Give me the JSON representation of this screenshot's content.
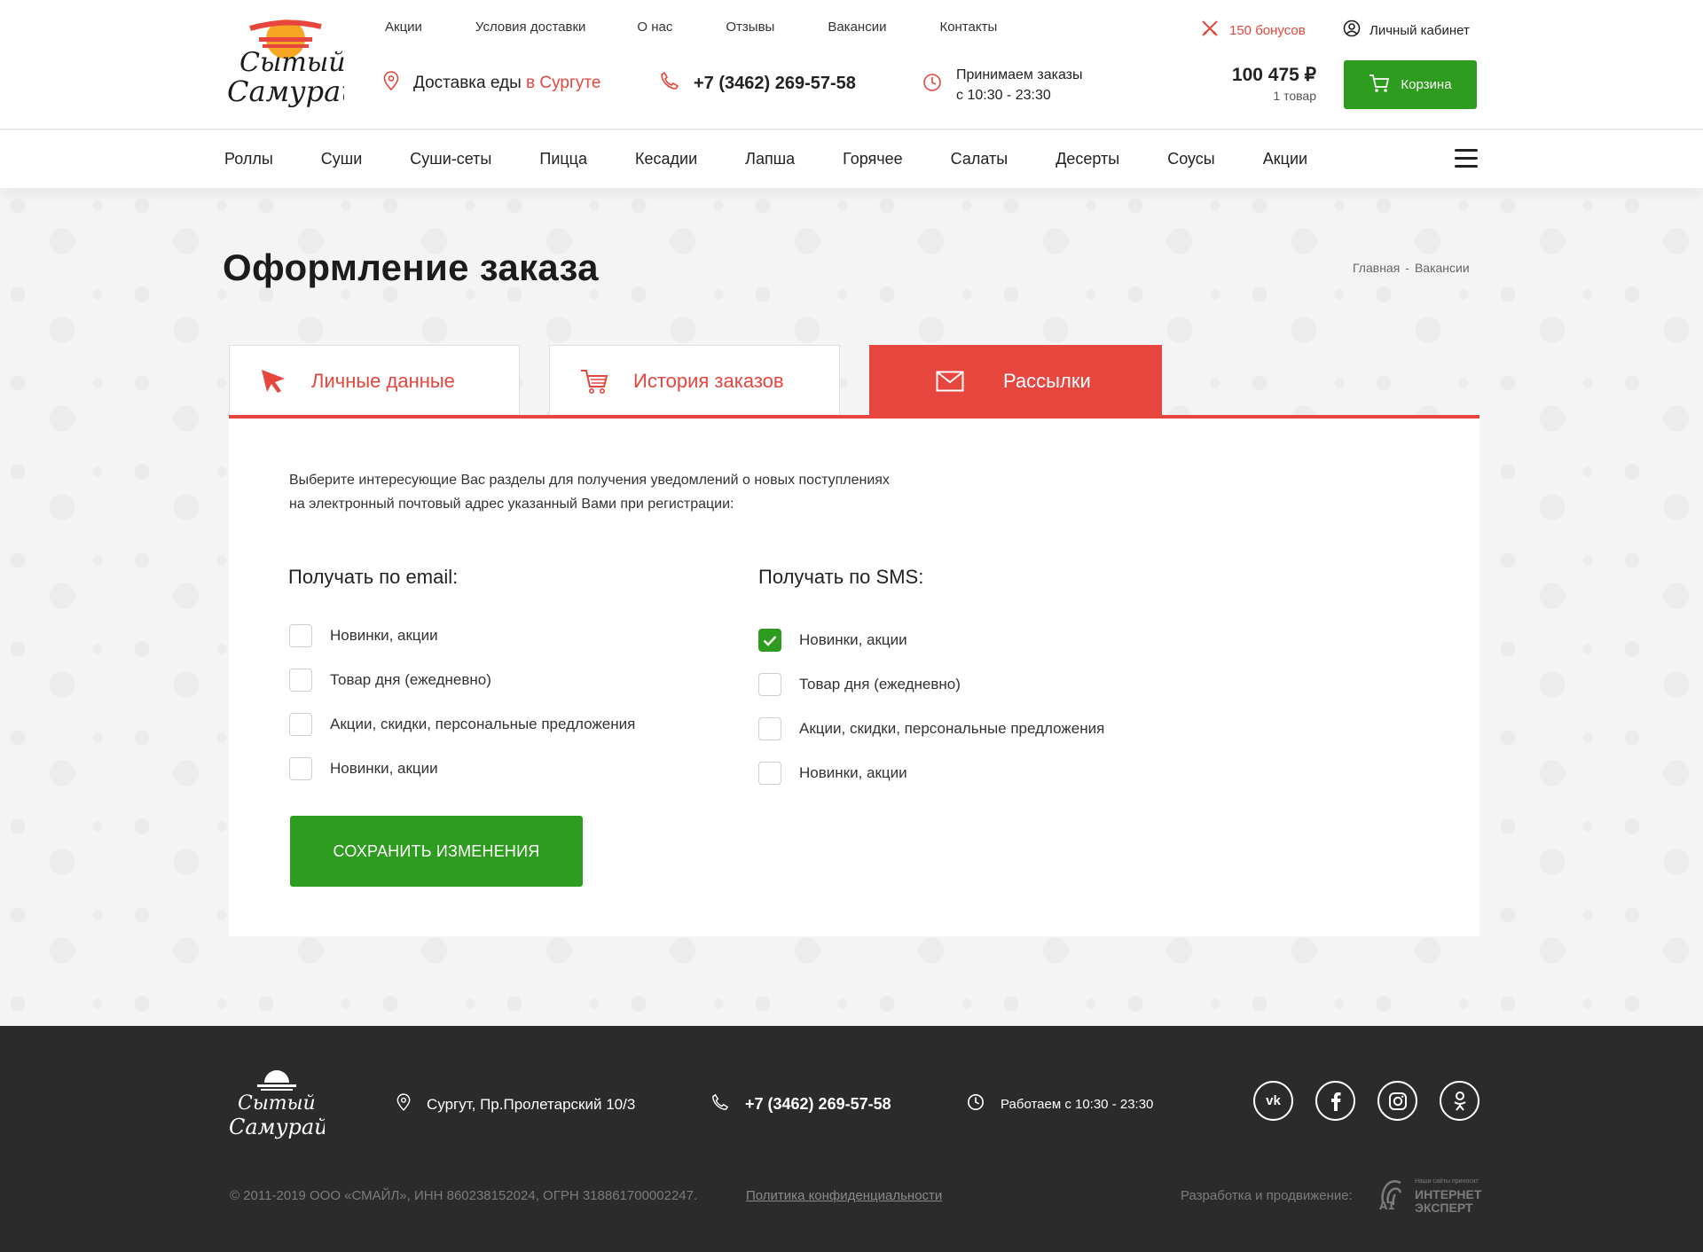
{
  "brand": {
    "name_line1": "Сытый",
    "name_line2": "Самурай"
  },
  "topnav": [
    "Акции",
    "Условия доставки",
    "О нас",
    "Отзывы",
    "Вакансии",
    "Контакты"
  ],
  "bonus": {
    "label": "150 бонусов"
  },
  "cabinet": {
    "label": "Личный кабинет"
  },
  "delivery": {
    "label": "Доставка еды",
    "city": "в Сургуте"
  },
  "phone": "+7 (3462) 269-57-58",
  "hours": {
    "line1": "Принимаем заказы",
    "line2": "с 10:30 - 23:30"
  },
  "cart": {
    "total": "100 475 ₽",
    "items": "1 товар",
    "button": "Корзина"
  },
  "categories": [
    "Роллы",
    "Суши",
    "Суши-сеты",
    "Пицца",
    "Кесадии",
    "Лапша",
    "Горячее",
    "Салаты",
    "Десерты",
    "Соусы",
    "Акции"
  ],
  "page": {
    "title": "Оформление заказа",
    "breadcrumb": [
      "Главная",
      "-",
      "Вакансии"
    ]
  },
  "tabs": [
    {
      "label": "Личные данные",
      "icon": "cursor-icon",
      "active": false
    },
    {
      "label": "История заказов",
      "icon": "cart-icon",
      "active": false
    },
    {
      "label": "Рассылки",
      "icon": "envelope-icon",
      "active": true
    }
  ],
  "panel": {
    "desc_line1": "Выберите интересующие Вас разделы для получения уведомлений о новых поступлениях",
    "desc_line2": "на электронный почтовый адрес указанный Вами при регистрации:",
    "email": {
      "title": "Получать по email:",
      "options": [
        {
          "label": "Новинки, акции",
          "checked": false
        },
        {
          "label": "Товар дня (ежедневно)",
          "checked": false
        },
        {
          "label": "Акции, скидки, персональные предложения",
          "checked": false
        },
        {
          "label": "Новинки, акции",
          "checked": false
        }
      ]
    },
    "sms": {
      "title": "Получать по SMS:",
      "options": [
        {
          "label": "Новинки, акции",
          "checked": true
        },
        {
          "label": "Товар дня (ежедневно)",
          "checked": false
        },
        {
          "label": "Акции, скидки, персональные предложения",
          "checked": false
        },
        {
          "label": "Новинки, акции",
          "checked": false
        }
      ]
    },
    "save_button": "СОХРАНИТЬ ИЗМЕНЕНИЯ"
  },
  "footer": {
    "address": "Сургут, Пр.Пролетарский 10/3",
    "phone": "+7 (3462) 269-57-58",
    "hours": "Работаем с 10:30 - 23:30",
    "socials": [
      "vk",
      "facebook",
      "instagram",
      "odnoklassniki"
    ],
    "copyright": "© 2011-2019   ООО «СМАЙЛ», ИНН 860238152024, ОГРН 318861700002247.",
    "policy": "Политика конфиденциальности",
    "dev_label": "Разработка и продвижение:",
    "dev_logo_small": "Наши сайты приносят",
    "dev_logo_line1": "ИНТЕРНЕТ",
    "dev_logo_line2": "ЭКСПЕРТ"
  },
  "colors": {
    "accent": "#e6463d",
    "green": "#2e9c1f",
    "footer": "#2b2b2b"
  }
}
